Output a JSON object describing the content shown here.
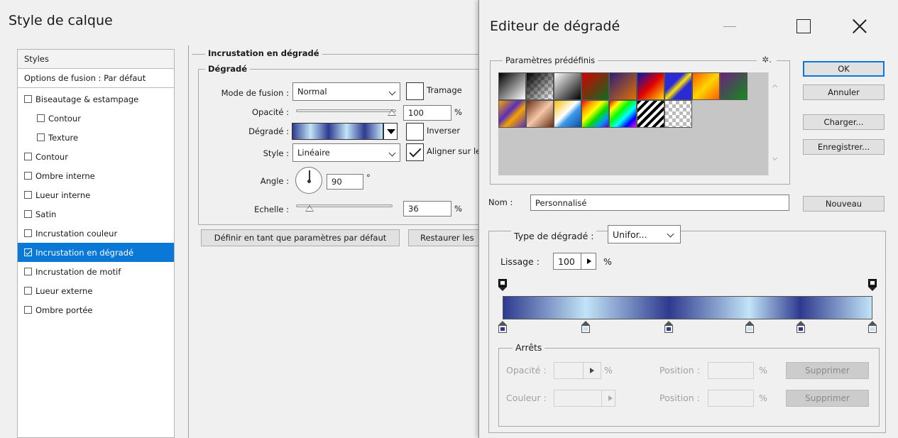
{
  "layer_style": {
    "title": "Style de calque",
    "styles_header": "Styles",
    "blend_options": "Options de fusion : Par défaut",
    "items": [
      {
        "label": "Biseautage & estampage",
        "checked": false,
        "sub": false
      },
      {
        "label": "Contour",
        "checked": false,
        "sub": true
      },
      {
        "label": "Texture",
        "checked": false,
        "sub": true
      },
      {
        "label": "Contour",
        "checked": false,
        "sub": false
      },
      {
        "label": "Ombre interne",
        "checked": false,
        "sub": false
      },
      {
        "label": "Lueur interne",
        "checked": false,
        "sub": false
      },
      {
        "label": "Satin",
        "checked": false,
        "sub": false
      },
      {
        "label": "Incrustation couleur",
        "checked": false,
        "sub": false
      },
      {
        "label": "Incrustation en dégradé",
        "checked": true,
        "sub": false,
        "selected": true
      },
      {
        "label": "Incrustation de motif",
        "checked": false,
        "sub": false
      },
      {
        "label": "Lueur externe",
        "checked": false,
        "sub": false
      },
      {
        "label": "Ombre portée",
        "checked": false,
        "sub": false
      }
    ],
    "section_title": "Incrustation en dégradé",
    "group_title": "Dégradé",
    "blend_mode_label": "Mode de fusion :",
    "blend_mode_value": "Normal",
    "dither_label": "Tramage",
    "dither_checked": false,
    "opacity_label": "Opacité :",
    "opacity_value": "100",
    "opacity_unit": "%",
    "gradient_label": "Dégradé :",
    "reverse_label": "Inverser",
    "reverse_checked": false,
    "style_label": "Style :",
    "style_value": "Linéaire",
    "align_label": "Aligner sur le",
    "align_checked": true,
    "angle_label": "Angle :",
    "angle_value": "90",
    "angle_unit": "°",
    "scale_label": "Echelle :",
    "scale_value": "36",
    "scale_unit": "%",
    "set_default_button": "Définir en tant que paramètres par défaut",
    "restore_default_button": "Restaurer les"
  },
  "gradient_editor": {
    "title": "Editeur de dégradé",
    "presets_title": "Paramètres prédéfinis",
    "gear_glyph": "✲.",
    "buttons": {
      "ok": "OK",
      "cancel": "Annuler",
      "load": "Charger...",
      "save": "Enregistrer...",
      "new": "Nouveau"
    },
    "name_label": "Nom :",
    "name_value": "Personnalisé",
    "type_label": "Type de dégradé :",
    "type_value": "Unifor...",
    "smoothness_label": "Lissage :",
    "smoothness_value": "100",
    "smoothness_unit": "%",
    "stops_title": "Arrêts",
    "stop_opacity_label": "Opacité :",
    "stop_color_label": "Couleur :",
    "position_label": "Position :",
    "percent": "%",
    "delete_button": "Supprimer",
    "color_stops": [
      {
        "position": 0.0,
        "color": "#2e3a8f"
      },
      {
        "position": 0.224,
        "color": "#c2e4f7"
      },
      {
        "position": 0.45,
        "color": "#2e3a8f"
      },
      {
        "position": 0.667,
        "color": "#c2e4f7"
      },
      {
        "position": 0.806,
        "color": "#2e3a8f"
      },
      {
        "position": 1.0,
        "color": "#c2e4f7"
      }
    ],
    "opacity_stops": [
      {
        "position": 0.0
      },
      {
        "position": 1.0
      }
    ]
  },
  "colors": {
    "selection": "#0a78d7",
    "gradient_dark": "#2e3a8f",
    "gradient_light": "#c2e4f7"
  }
}
